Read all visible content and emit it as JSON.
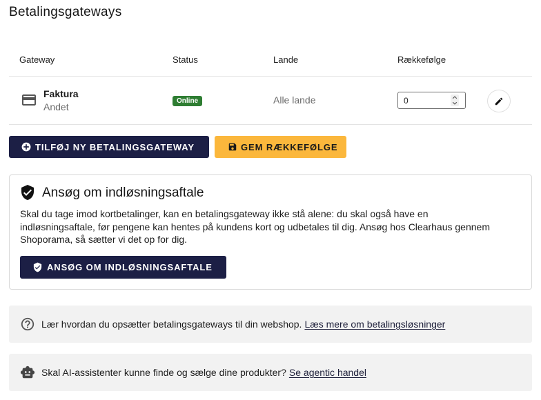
{
  "page": {
    "title": "Betalingsgateways"
  },
  "table": {
    "headers": {
      "gateway": "Gateway",
      "status": "Status",
      "countries": "Lande",
      "order": "Rækkefølge"
    },
    "rows": [
      {
        "icon": "credit-card-icon",
        "name": "Faktura",
        "type": "Andet",
        "status": "Online",
        "countries": "Alle lande",
        "order": "0",
        "edit_icon": "pencil-icon"
      }
    ]
  },
  "actions": {
    "add_icon": "plus-circle-icon",
    "add_label": "TILFØJ NY BETALINGSGATEWAY",
    "save_icon": "floppy-disk-icon",
    "save_label": "GEM RÆKKEFØLGE"
  },
  "acquiring": {
    "icon": "shield-check-icon",
    "title": "Ansøg om indløsningsaftale",
    "body": "Skal du tage imod kortbetalinger, kan en betalingsgateway ikke stå alene: du skal også have en indløsningsaftale, før pengene kan hentes på kundens kort og udbetales til dig. Ansøg hos Clearhaus gennem Shoporama, så sætter vi det op for dig.",
    "button_icon": "shield-check-icon",
    "button_label": "ANSØG OM INDLØSNINGSAFTALE"
  },
  "info": [
    {
      "icon": "help-circle-icon",
      "text": "Lær hvordan du opsætter betalingsgateways til din webshop.",
      "link": "Læs mere om betalingsløsninger"
    },
    {
      "icon": "robot-icon",
      "text": "Skal AI-assistenter kunne finde og sælge dine produkter?",
      "link": "Se agentic handel"
    }
  ],
  "colors": {
    "primary": "#1c1f45",
    "accent": "#fbb73c",
    "success": "#2e7d32",
    "muted_bg": "#f2f2f2",
    "border": "#e3e3e3",
    "text": "#1d1d1d",
    "muted_text": "#6b6b6b",
    "link": "#1d1f3a"
  }
}
